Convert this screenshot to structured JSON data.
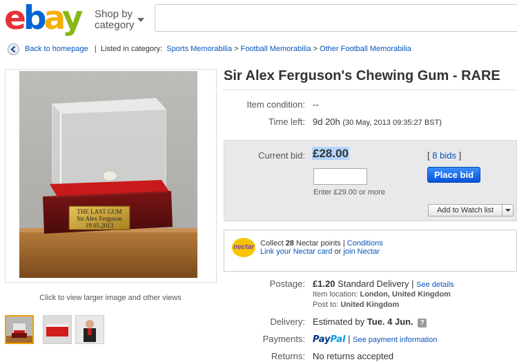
{
  "header": {
    "logo": {
      "e": "e",
      "b": "b",
      "a": "a",
      "y": "y"
    },
    "shop_by_line1": "Shop by",
    "shop_by_line2": "category",
    "search_value": ""
  },
  "breadcrumb": {
    "back": "Back to homepage",
    "listed": "Listed in category:",
    "path": [
      "Sports Memorabilia",
      "Football Memorabilia",
      "Other Football Memorabilia"
    ],
    "separator": ">"
  },
  "gallery": {
    "plaque_lines": [
      "THE LAST GUM",
      "Sir Alex Ferguson",
      "19.05.2013"
    ],
    "caption": "Click to view larger image and other views"
  },
  "item": {
    "title": "Sir Alex Ferguson's Chewing Gum - RARE",
    "condition_label": "Item condition:",
    "condition_value": "--",
    "time_label": "Time left:",
    "time_value": "9d 20h",
    "time_detail": "(30 May, 2013   09:35:27 BST)"
  },
  "bid": {
    "current_label": "Current bid:",
    "price": "£28.00",
    "bids_open": "[",
    "bids_link": "8 bids",
    "bids_close": "]",
    "input_value": "",
    "enter_hint": "Enter £29.00 or more",
    "place_bid": "Place bid",
    "watch": "Add to Watch list"
  },
  "nectar": {
    "logo": "nectar",
    "collect": "Collect",
    "points": "28",
    "nectar_points": "Nectar points |",
    "conditions": "Conditions",
    "link_card": "Link your Nectar card",
    "or": "or",
    "join": "join Nectar"
  },
  "shipping": {
    "postage_label": "Postage:",
    "postage_price": "£1.20",
    "postage_method": "Standard Delivery |",
    "see_details": "See details",
    "location_label": "Item location:",
    "location_value": "London, United Kingdom",
    "post_to_label": "Post to:",
    "post_to_value": "United Kingdom",
    "delivery_label": "Delivery:",
    "delivery_prefix": "Estimated by",
    "delivery_date": "Tue. 4 Jun.",
    "help": "?",
    "payments_label": "Payments:",
    "paypal_1": "Pay",
    "paypal_2": "Pal",
    "payment_sep": "|",
    "see_payment": "See payment information",
    "returns_label": "Returns:",
    "returns_value": "No returns accepted"
  },
  "colors": {
    "accent_blue": "#0654ba",
    "price_highlight": "#b3d4fc",
    "place_bid": "#0654d8"
  }
}
